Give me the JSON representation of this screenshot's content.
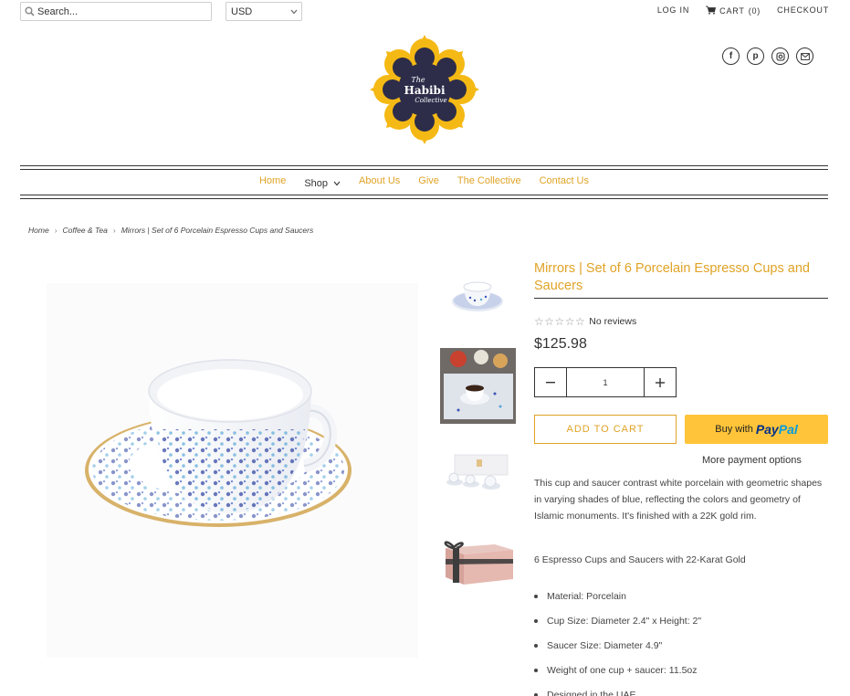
{
  "header": {
    "search_placeholder": "Search...",
    "currency": "USD",
    "login": "LOG IN",
    "cart_label": "CART",
    "cart_count": "(0)",
    "checkout": "CHECKOUT"
  },
  "logo": {
    "line1": "The",
    "line2": "Habibi",
    "line3": "Collective",
    "colors": {
      "gold": "#f5b915",
      "navy": "#2d2d4a"
    }
  },
  "social": [
    "facebook-icon",
    "pinterest-icon",
    "instagram-icon",
    "email-icon"
  ],
  "nav": {
    "items": [
      "Home",
      "Shop",
      "About Us",
      "Give",
      "The Collective",
      "Contact Us"
    ]
  },
  "breadcrumb": [
    "Home",
    "Coffee & Tea",
    "Mirrors | Set of 6 Porcelain Espresso Cups and Saucers"
  ],
  "product": {
    "title": "Mirrors | Set of 6 Porcelain Espresso Cups and Saucers",
    "reviews": "No reviews",
    "price": "$125.98",
    "quantity": "1",
    "add_to_cart": "ADD TO CART",
    "paypal_prefix": "Buy with",
    "paypal_brand_1": "Pay",
    "paypal_brand_2": "Pal",
    "more_payment": "More payment options",
    "description": "This cup and saucer contrast white porcelain with geometric shapes in varying shades of blue, reflecting the colors and geometry of Islamic monuments. It's finished with a 22K gold rim.",
    "subline": "6 Espresso Cups and Saucers with 22-Karat Gold",
    "specs": [
      "Material: Porcelain",
      "Cup Size: Diameter 2.4\" x Height: 2\"",
      "Saucer Size: Diameter 4.9\"",
      "Weight of one cup + saucer: 11.5oz",
      "Designed in the UAE"
    ]
  },
  "colors": {
    "accent": "#e0a326",
    "paypal": "#ffc439"
  }
}
